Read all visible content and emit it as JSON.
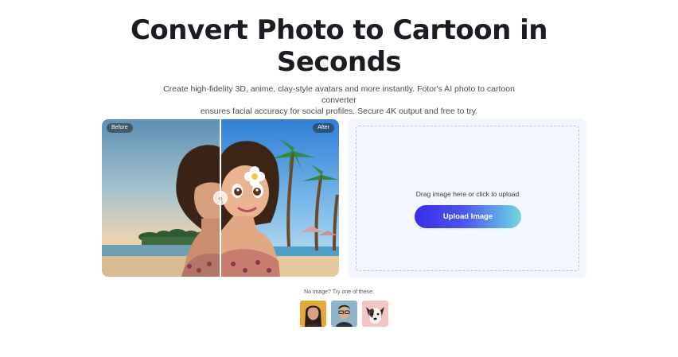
{
  "hero": {
    "title_line1": "Convert Photo to Cartoon in",
    "title_line2": "Seconds",
    "subtitle_line1": "Create high-fidelity 3D, anime, clay-style avatars and more instantly. Fotor's AI photo to cartoon converter",
    "subtitle_line2": "ensures facial accuracy for social profiles. Secure 4K output and free to try."
  },
  "compare": {
    "before_label": "Before",
    "after_label": "After",
    "handle_icon": "chevron-left-right-icon",
    "split": 0.5
  },
  "upload": {
    "hint": "Drag image here or click to upload",
    "button_label": "Upload Image"
  },
  "samples": {
    "label": "No image? Try one of these:",
    "items": [
      {
        "name": "woman-portrait-sample"
      },
      {
        "name": "man-portrait-sample"
      },
      {
        "name": "dog-portrait-sample"
      }
    ]
  },
  "colors": {
    "accent_start": "#3a2de6",
    "accent_end": "#6fdadb",
    "panel_bg": "#f3f6fd"
  }
}
